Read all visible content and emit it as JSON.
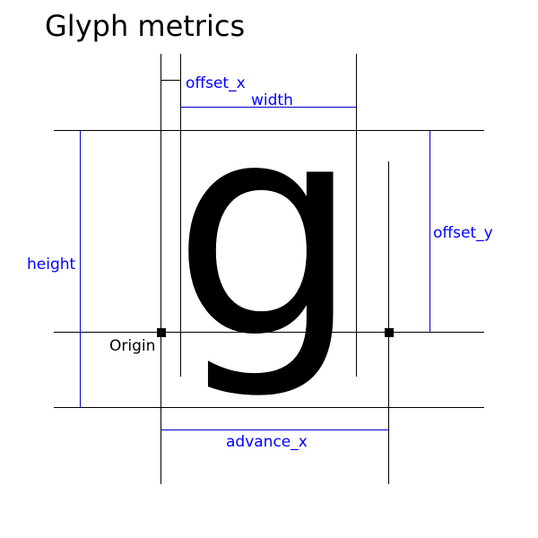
{
  "title": "Glyph metrics",
  "glyph": {
    "char": "g",
    "color": "#000000"
  },
  "labels": {
    "offset_x": "offset_x",
    "width": "width",
    "offset_y": "offset_y",
    "height": "height",
    "origin": "Origin",
    "advance_x": "advance_x"
  },
  "colors": {
    "guide": "#000000",
    "dimension": "#0000cc",
    "label": "#0000ff",
    "origin_text": "#000000"
  }
}
